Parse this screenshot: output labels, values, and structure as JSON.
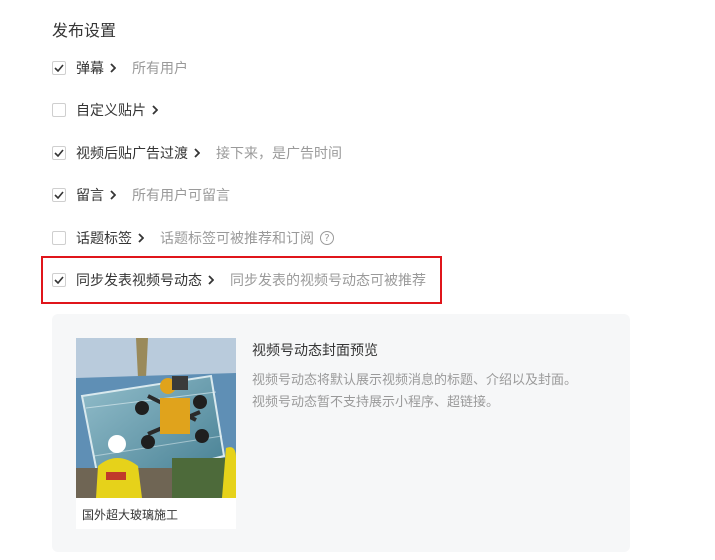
{
  "section_title": "发布设置",
  "options": [
    {
      "label": "弹幕",
      "desc": "所有用户",
      "checked": true,
      "has_help": false
    },
    {
      "label": "自定义贴片",
      "desc": "",
      "checked": false,
      "has_help": false
    },
    {
      "label": "视频后贴广告过渡",
      "desc": "接下来，是广告时间",
      "checked": true,
      "has_help": false
    },
    {
      "label": "留言",
      "desc": "所有用户可留言",
      "checked": true,
      "has_help": false
    },
    {
      "label": "话题标签",
      "desc": "话题标签可被推荐和订阅",
      "checked": false,
      "has_help": true
    },
    {
      "label": "同步发表视频号动态",
      "desc": "同步发表的视频号动态可被推荐",
      "checked": true,
      "has_help": false,
      "highlighted": true
    }
  ],
  "help_glyph": "?",
  "highlight_color": "#e0151b",
  "preview": {
    "title": "视频号动态封面预览",
    "desc_lines": [
      "视频号动态将默认展示视频消息的标题、介绍以及封面。",
      "视频号动态暂不支持展示小程序、超链接。"
    ],
    "card_caption": "国外超大玻璃施工"
  }
}
